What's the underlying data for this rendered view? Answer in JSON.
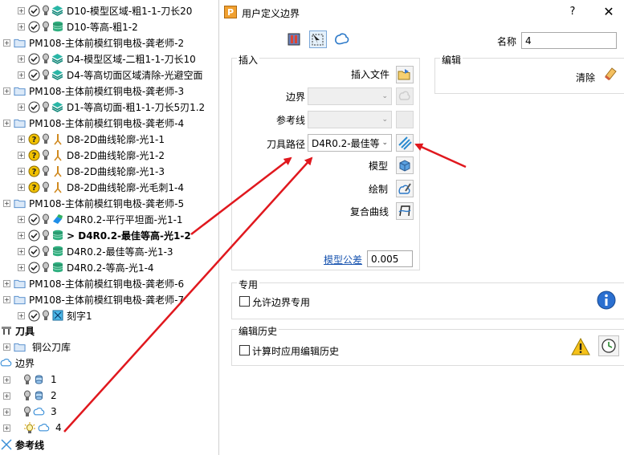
{
  "tree": {
    "rows": [
      {
        "id": "r0",
        "text": "D10-模型区域-粗1-1-刀长20",
        "level": 2,
        "status": "check",
        "icon": "layers-icon"
      },
      {
        "id": "r1",
        "text": "D10-等高-粗1-2",
        "level": 2,
        "status": "check",
        "icon": "db-icon"
      },
      {
        "id": "r2",
        "text": "PM108-主体前模红铜电极-龚老师-2",
        "level": 1,
        "status": "",
        "icon": "folder-icon"
      },
      {
        "id": "r3",
        "text": "D4-模型区域-二粗1-1-刀长10",
        "level": 2,
        "status": "check",
        "icon": "layers-icon"
      },
      {
        "id": "r4",
        "text": "D4-等高切面区域清除-光避空面",
        "level": 2,
        "status": "check",
        "icon": "layers-icon"
      },
      {
        "id": "r5",
        "text": "PM108-主体前模红铜电极-龚老师-3",
        "level": 1,
        "status": "",
        "icon": "folder-icon"
      },
      {
        "id": "r6",
        "text": "D1-等高切面-粗1-1-刀长5刃1.2",
        "level": 2,
        "status": "check",
        "icon": "layers-icon"
      },
      {
        "id": "r7",
        "text": "PM108-主体前模红铜电极-龚老师-4",
        "level": 1,
        "status": "",
        "icon": "folder-icon"
      },
      {
        "id": "r8",
        "text": "D8-2D曲线轮廓-光1-1",
        "level": 2,
        "status": "question",
        "icon": "tool-icon"
      },
      {
        "id": "r9",
        "text": "D8-2D曲线轮廓-光1-2",
        "level": 2,
        "status": "question",
        "icon": "tool-icon"
      },
      {
        "id": "r10",
        "text": "D8-2D曲线轮廓-光1-3",
        "level": 2,
        "status": "question",
        "icon": "tool-icon"
      },
      {
        "id": "r11",
        "text": "D8-2D曲线轮廓-光毛刺1-4",
        "level": 2,
        "status": "question",
        "icon": "tool-icon"
      },
      {
        "id": "r12",
        "text": "PM108-主体前模红铜电极-龚老师-5",
        "level": 1,
        "status": "",
        "icon": "folder-icon"
      },
      {
        "id": "r13",
        "text": "D4R0.2-平行平坦面-光1-1",
        "level": 2,
        "status": "check",
        "icon": "flat-icon"
      },
      {
        "id": "r14",
        "text": "> D4R0.2-最佳等高-光1-2",
        "level": 2,
        "status": "check",
        "icon": "db-icon",
        "bold": true
      },
      {
        "id": "r15",
        "text": "D4R0.2-最佳等高-光1-3",
        "level": 2,
        "status": "check",
        "icon": "db-icon"
      },
      {
        "id": "r16",
        "text": "D4R0.2-等高-光1-4",
        "level": 2,
        "status": "check",
        "icon": "db-icon"
      },
      {
        "id": "r17",
        "text": "PM108-主体前模红铜电极-龚老师-6",
        "level": 1,
        "status": "",
        "icon": "folder-icon"
      },
      {
        "id": "r18",
        "text": "PM108-主体前模红铜电极-龚老师-7",
        "level": 1,
        "status": "",
        "icon": "folder-icon"
      },
      {
        "id": "r19",
        "text": "刻字1",
        "level": 2,
        "status": "check",
        "icon": "engrave-icon"
      }
    ],
    "tools_label": "刀具",
    "tool_library_label": "铜公刀库",
    "boundaries_label": "边界",
    "boundary_items": [
      "1",
      "2",
      "3",
      "4"
    ],
    "reference_lines_label": "参考线"
  },
  "dialog": {
    "title": "用户定义边界",
    "help": "?",
    "close": "✕",
    "name_label": "名称",
    "name_value": "4",
    "insert_group": "插入",
    "insert_file_label": "插入文件",
    "boundary_label": "边界",
    "boundary_value": "",
    "reference_line_label": "参考线",
    "reference_line_value": "",
    "toolpath_label": "刀具路径",
    "toolpath_value": "D4R0.2-最佳等",
    "model_label": "模型",
    "draw_label": "绘制",
    "composite_curve_label": "复合曲线",
    "model_tolerance_label": "模型公差",
    "model_tolerance_value": "0.005",
    "edit_group": "编辑",
    "clear_label": "清除",
    "private_group": "专用",
    "private_checkbox_label": "允许边界专用",
    "history_group": "编辑历史",
    "history_checkbox_label": "计算时应用编辑历史"
  },
  "colors": {
    "accent": "#1a55b0",
    "arrow": "#e0181e",
    "check": "#222222",
    "question": "#f2c200"
  }
}
